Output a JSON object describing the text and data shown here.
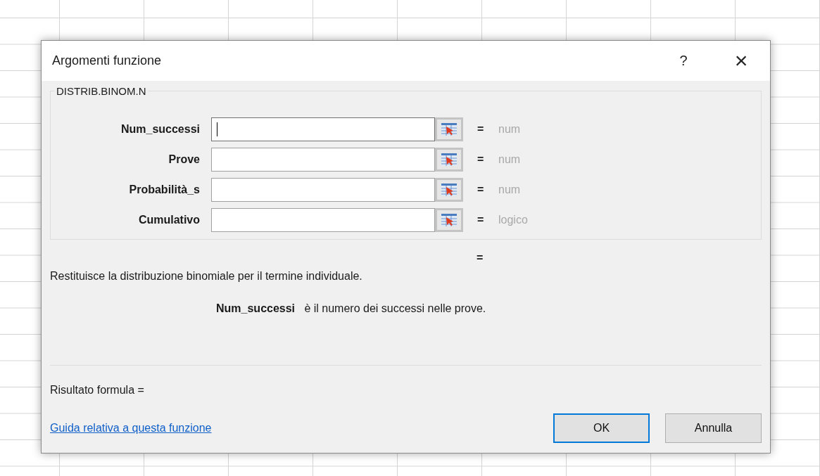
{
  "window": {
    "title": "Argomenti funzione",
    "help_button": "?",
    "close_button": "×"
  },
  "function_group": {
    "name": "DISTRIB.BINOM.N",
    "arguments": [
      {
        "label": "Num_successi",
        "focused": true,
        "equals": "=",
        "hint": "num"
      },
      {
        "label": "Prove",
        "focused": false,
        "equals": "=",
        "hint": "num"
      },
      {
        "label": "Probabilità_s",
        "focused": false,
        "equals": "=",
        "hint": "num"
      },
      {
        "label": "Cumulativo",
        "focused": false,
        "equals": "=",
        "hint": "logico"
      }
    ]
  },
  "result_equals": "=",
  "description": "Restituisce la distribuzione binomiale per il termine individuale.",
  "argument_help": {
    "name": "Num_successi",
    "text": "è il numero dei successi nelle prove."
  },
  "formula_result": "Risultato formula =",
  "help_link": "Guida relativa a questa funzione",
  "buttons": [
    {
      "label": "OK",
      "default": true
    },
    {
      "label": "Annulla",
      "default": false
    }
  ]
}
